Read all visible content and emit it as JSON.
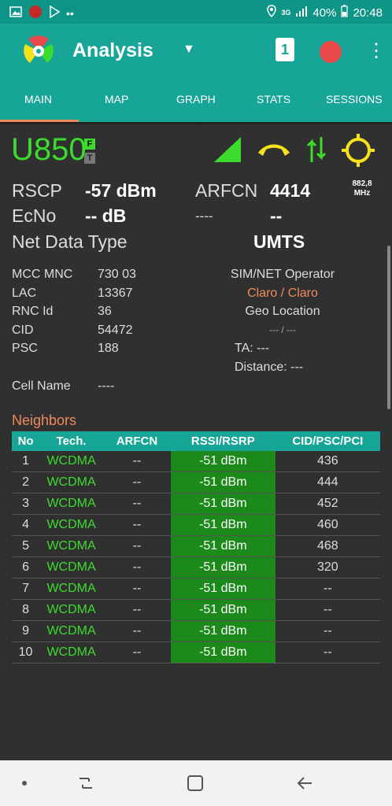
{
  "status_bar": {
    "icons_left": [
      "image-icon",
      "app-badge-icon",
      "play-store-icon",
      "more-dots-icon"
    ],
    "network": "3G",
    "battery": "40%",
    "time": "20:48"
  },
  "app_bar": {
    "title": "Analysis",
    "sim_slot": "1"
  },
  "tabs": [
    "MAIN",
    "MAP",
    "GRAPH",
    "STATS",
    "SESSIONS"
  ],
  "colors": {
    "accent": "#16a596",
    "signal_green": "#3cdc2c",
    "call_yellow": "#f7e11b",
    "warning_orange": "#f08a5d",
    "record_red": "#e8484a"
  },
  "serving": {
    "band": "U850",
    "badge_f": "F",
    "badge_t": "T",
    "rscp_label": "RSCP",
    "rscp_value": "-57 dBm",
    "arfcn_label": "ARFCN",
    "arfcn_value": "4414",
    "freq_value": "882,8",
    "freq_unit": "MHz",
    "ecno_label": "EcNo",
    "ecno_value": "-- dB",
    "extra_label": "----",
    "extra_value": "--",
    "net_data_type_label": "Net Data Type",
    "net_data_type_value": "UMTS"
  },
  "cell_info": {
    "mcc_mnc_label": "MCC MNC",
    "mcc_mnc_value": "730 03",
    "lac_label": "LAC",
    "lac_value": "13367",
    "rnc_label": "RNC Id",
    "rnc_value": "36",
    "cid_label": "CID",
    "cid_value": "54472",
    "psc_label": "PSC",
    "psc_value": "188",
    "cell_name_label": "Cell Name",
    "cell_name_value": "----"
  },
  "operator": {
    "label": "SIM/NET Operator",
    "value": "Claro / Claro",
    "geo_label": "Geo Location",
    "geo_value": "--- / ---",
    "ta_label": "TA: ---",
    "distance_label": "Distance: ---"
  },
  "neighbors": {
    "title": "Neighbors",
    "columns": [
      "No",
      "Tech.",
      "ARFCN",
      "RSSI/RSRP",
      "CID/PSC/PCI"
    ],
    "rows": [
      [
        "1",
        "WCDMA",
        "--",
        "-51 dBm",
        "436"
      ],
      [
        "2",
        "WCDMA",
        "--",
        "-51 dBm",
        "444"
      ],
      [
        "3",
        "WCDMA",
        "--",
        "-51 dBm",
        "452"
      ],
      [
        "4",
        "WCDMA",
        "--",
        "-51 dBm",
        "460"
      ],
      [
        "5",
        "WCDMA",
        "--",
        "-51 dBm",
        "468"
      ],
      [
        "6",
        "WCDMA",
        "--",
        "-51 dBm",
        "320"
      ],
      [
        "7",
        "WCDMA",
        "--",
        "-51 dBm",
        "--"
      ],
      [
        "8",
        "WCDMA",
        "--",
        "-51 dBm",
        "--"
      ],
      [
        "9",
        "WCDMA",
        "--",
        "-51 dBm",
        "--"
      ],
      [
        "10",
        "WCDMA",
        "--",
        "-51 dBm",
        "--"
      ]
    ]
  }
}
